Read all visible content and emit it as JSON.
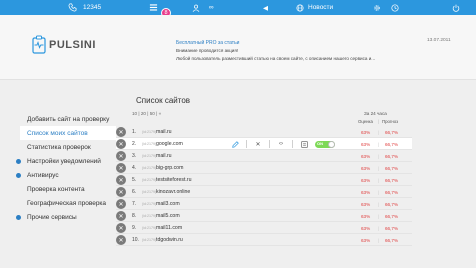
{
  "topbar": {
    "phone": "12345",
    "badge": "8",
    "news_label": "Новости"
  },
  "header": {
    "logo_text": "PULSINI",
    "news_title": "Бесплатный PRO за статьи",
    "news_line1": "Внимание проводится акция!",
    "news_line2": "Любой пользователь разместивший статью на своем сайте, с описанием нашего сервиса и...",
    "news_date": "13.07.2011"
  },
  "sidebar": {
    "items": [
      {
        "label": "Добавить сайт на проверку"
      },
      {
        "label": "Список моих сайтов"
      },
      {
        "label": "Статистика проверок"
      },
      {
        "label": "Настройки уведомлений"
      },
      {
        "label": "Антивирус"
      },
      {
        "label": "Проверка контента"
      },
      {
        "label": "Географическая проверка"
      },
      {
        "label": "Прочие сервисы"
      }
    ]
  },
  "main": {
    "title": "Список сайтов",
    "pager": "10 | 20 | 50 | «",
    "period": "За 24 часа",
    "col_rating": "Оценка",
    "col_sep": "|",
    "col_loss": "Прогноз",
    "toggle_label": "ON",
    "rows": [
      {
        "num": "1.",
        "sid": "(id:2179)",
        "host": "mail.ru",
        "v1": "63%",
        "v2": "66,7%"
      },
      {
        "num": "2.",
        "sid": "(id:2179)",
        "host": "google.com",
        "v1": "63%",
        "v2": "66,7%"
      },
      {
        "num": "3.",
        "sid": "(id:2179)",
        "host": "mail.ru",
        "v1": "63%",
        "v2": "66,7%"
      },
      {
        "num": "4.",
        "sid": "(id:2179)",
        "host": "big-grp.com",
        "v1": "63%",
        "v2": "66,7%"
      },
      {
        "num": "5.",
        "sid": "(id:2179)",
        "host": "testsiteforest.ru",
        "v1": "63%",
        "v2": "66,7%"
      },
      {
        "num": "6.",
        "sid": "(id:2179)",
        "host": "kinozavr.online",
        "v1": "63%",
        "v2": "66,7%"
      },
      {
        "num": "7.",
        "sid": "(id:2179)",
        "host": "mail3.com",
        "v1": "63%",
        "v2": "66,7%"
      },
      {
        "num": "8.",
        "sid": "(id:2179)",
        "host": "mail5.com",
        "v1": "63%",
        "v2": "66,7%"
      },
      {
        "num": "9.",
        "sid": "(id:2179)",
        "host": "mail11.com",
        "v1": "63%",
        "v2": "66,7%"
      },
      {
        "num": "10.",
        "sid": "(id:2179)",
        "host": "tdgodwin.ru",
        "v1": "63%",
        "v2": "66,7%"
      }
    ]
  },
  "colors": {
    "accent": "#2c97de",
    "badge": "#e83e8c",
    "value": "#e04040",
    "toggle": "#7ed957"
  }
}
